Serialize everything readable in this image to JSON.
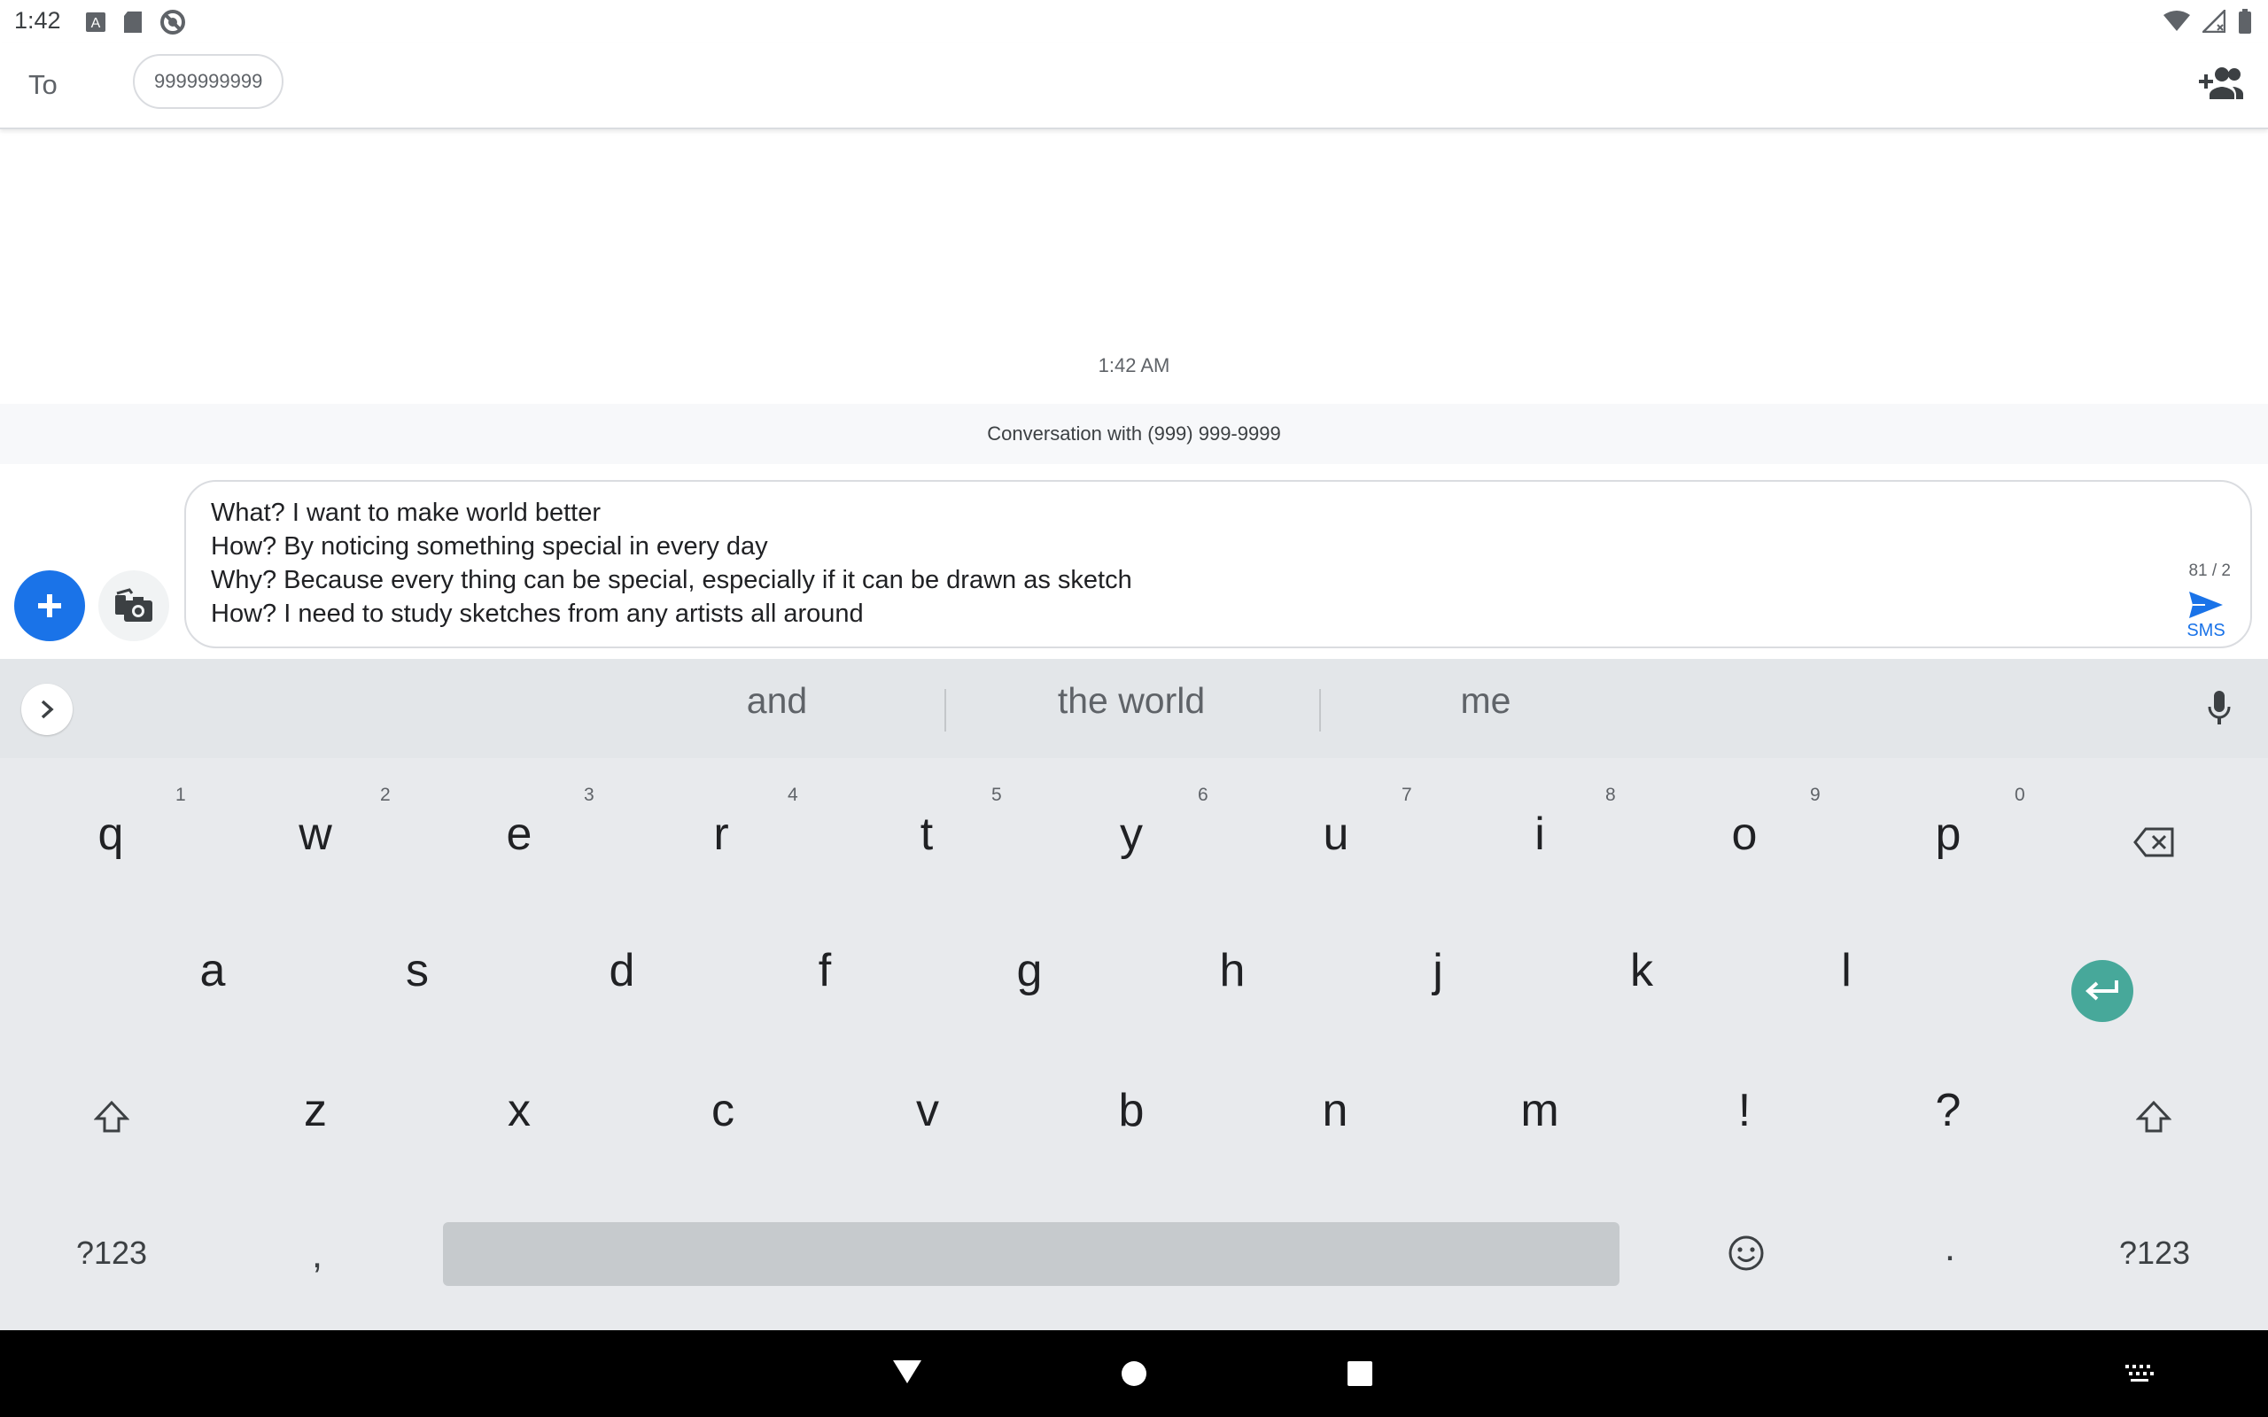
{
  "status_bar": {
    "time": "1:42",
    "left_icons": [
      "a-badge-icon",
      "sd-card-icon",
      "sync-off-icon"
    ],
    "right_icons": [
      "wifi-icon",
      "signal-icon",
      "battery-icon"
    ]
  },
  "recipient": {
    "to_label": "To",
    "chip_text": "9999999999",
    "add_icon": "add-person-icon"
  },
  "conversation": {
    "timestamp": "1:42 AM",
    "banner": "Conversation with (999) 999-9999"
  },
  "compose": {
    "text": "What? I want to make world better\nHow? By noticing something special in every day\nWhy? Because every thing can be special, especially if it can be drawn as sketch\nHow? I need to study sketches from any artists all around",
    "counter": "81 / 2",
    "send_label": "SMS"
  },
  "keyboard": {
    "suggestions": [
      "and",
      "the world",
      "me"
    ],
    "row1": [
      "q",
      "w",
      "e",
      "r",
      "t",
      "y",
      "u",
      "i",
      "o",
      "p"
    ],
    "row1_hints": [
      "1",
      "2",
      "3",
      "4",
      "5",
      "6",
      "7",
      "8",
      "9",
      "0"
    ],
    "row2": [
      "a",
      "s",
      "d",
      "f",
      "g",
      "h",
      "j",
      "k",
      "l"
    ],
    "row3": [
      "z",
      "x",
      "c",
      "v",
      "b",
      "n",
      "m",
      "!",
      "?"
    ],
    "symbols_left": "?123",
    "comma": ",",
    "period": ".",
    "symbols_right": "?123",
    "accent_color": "#47a89a"
  },
  "navbar": {
    "icons": [
      "back-icon",
      "home-icon",
      "recents-icon",
      "keyboard-switch-icon"
    ]
  }
}
